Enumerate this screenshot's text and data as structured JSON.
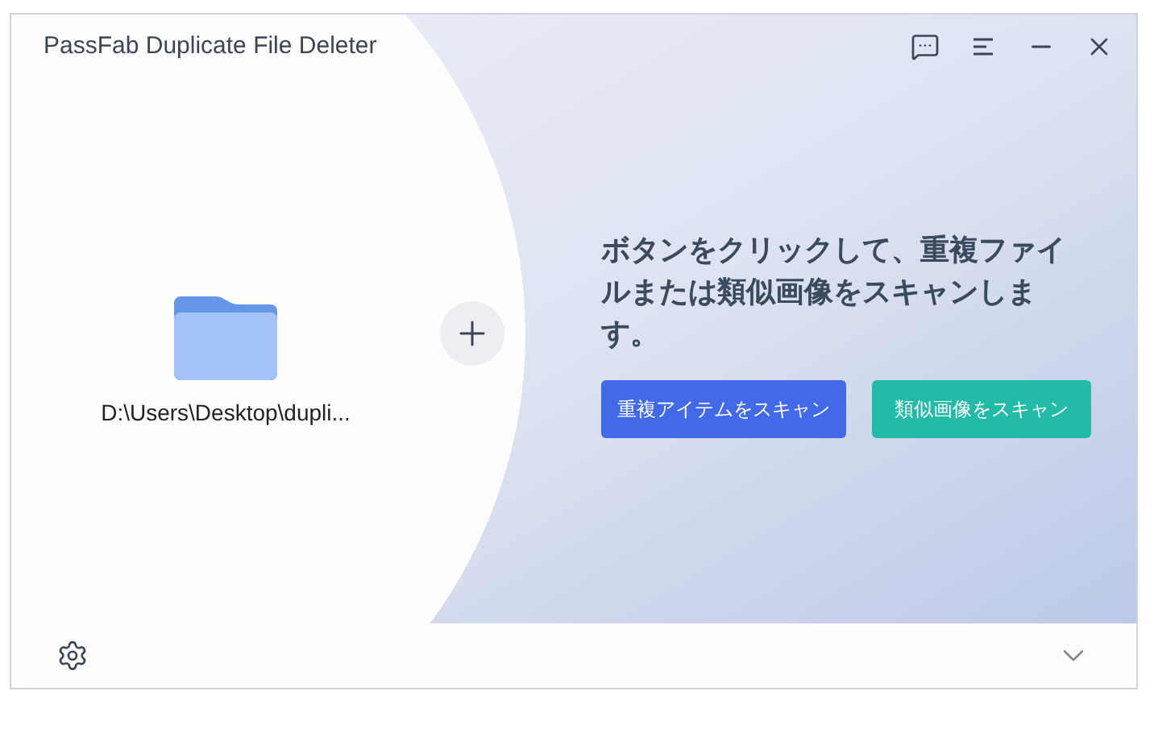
{
  "window": {
    "title": "PassFab Duplicate File Deleter"
  },
  "folder": {
    "path": "D:\\Users\\Desktop\\dupli..."
  },
  "prompt": "ボタンをクリックして、重複ファイルまたは類似画像をスキャンします。",
  "buttons": [
    {
      "label": "重複アイテムをスキャン",
      "kind": "primary"
    },
    {
      "label": "類似画像をスキャン",
      "kind": "secondary"
    }
  ]
}
